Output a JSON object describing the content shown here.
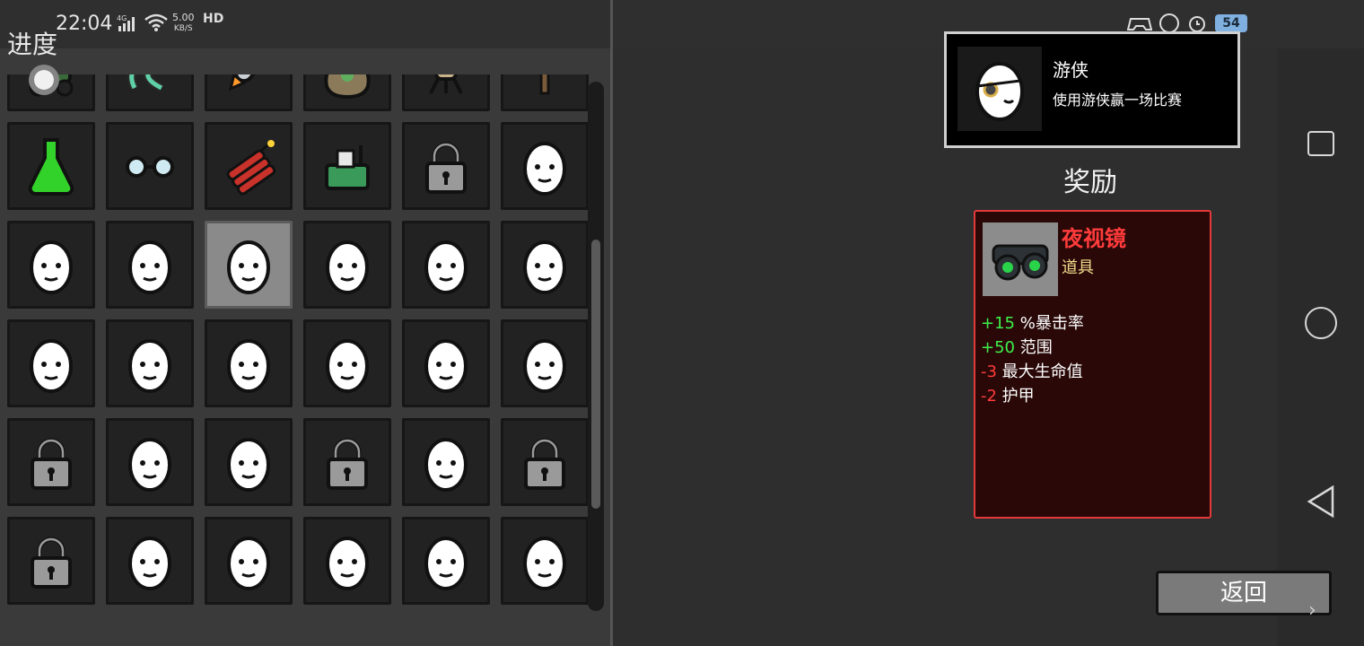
{
  "status_bar": {
    "time": "22:04",
    "network": "4G",
    "speed_value": "5.00",
    "speed_unit": "KB/S",
    "hd_label": "HD",
    "battery": "54"
  },
  "left_panel": {
    "title": "进度",
    "grid_items": [
      {
        "icon": "lawnmower-icon"
      },
      {
        "icon": "green-tentacle-icon"
      },
      {
        "icon": "rocket-icon"
      },
      {
        "icon": "money-bag-icon"
      },
      {
        "icon": "turret-icon"
      },
      {
        "icon": "tree-icon"
      },
      {
        "icon": "potion-flask-icon"
      },
      {
        "icon": "glasses-icon"
      },
      {
        "icon": "dynamite-icon"
      },
      {
        "icon": "green-machine-icon"
      },
      {
        "icon": "lock-icon"
      },
      {
        "icon": "egg-character-icon"
      },
      {
        "icon": "egg-character-icon"
      },
      {
        "icon": "egg-character-icon"
      },
      {
        "icon": "egg-character-icon",
        "selected": true
      },
      {
        "icon": "egg-character-icon"
      },
      {
        "icon": "egg-character-icon"
      },
      {
        "icon": "egg-character-icon"
      },
      {
        "icon": "egg-character-icon"
      },
      {
        "icon": "egg-character-icon"
      },
      {
        "icon": "egg-character-icon"
      },
      {
        "icon": "egg-character-icon"
      },
      {
        "icon": "egg-character-icon"
      },
      {
        "icon": "egg-character-icon"
      },
      {
        "icon": "lock-icon"
      },
      {
        "icon": "egg-character-icon"
      },
      {
        "icon": "egg-character-icon"
      },
      {
        "icon": "lock-icon"
      },
      {
        "icon": "egg-character-icon"
      },
      {
        "icon": "lock-icon"
      },
      {
        "icon": "lock-icon"
      },
      {
        "icon": "egg-character-icon"
      },
      {
        "icon": "egg-character-icon"
      },
      {
        "icon": "egg-character-icon"
      },
      {
        "icon": "egg-character-icon"
      },
      {
        "icon": "egg-character-icon"
      }
    ]
  },
  "achievement": {
    "name": "游侠",
    "description": "使用游侠赢一场比赛",
    "icon": "ranger-egg-icon"
  },
  "reward": {
    "title": "奖励",
    "item_name": "夜视镜",
    "item_type": "道具",
    "item_icon": "binoculars-icon",
    "stats": [
      {
        "value": "+15",
        "label": " %暴击率",
        "kind": "pos"
      },
      {
        "value": "+50",
        "label": " 范围",
        "kind": "pos"
      },
      {
        "value": "-3",
        "label": " 最大生命值",
        "kind": "neg"
      },
      {
        "value": "-2",
        "label": " 护甲",
        "kind": "neg"
      }
    ]
  },
  "back_button": {
    "label": "返回"
  },
  "colors": {
    "accent_red": "#ff3b3b",
    "positive_green": "#3df04a",
    "item_type_gold": "#f0d98a"
  }
}
